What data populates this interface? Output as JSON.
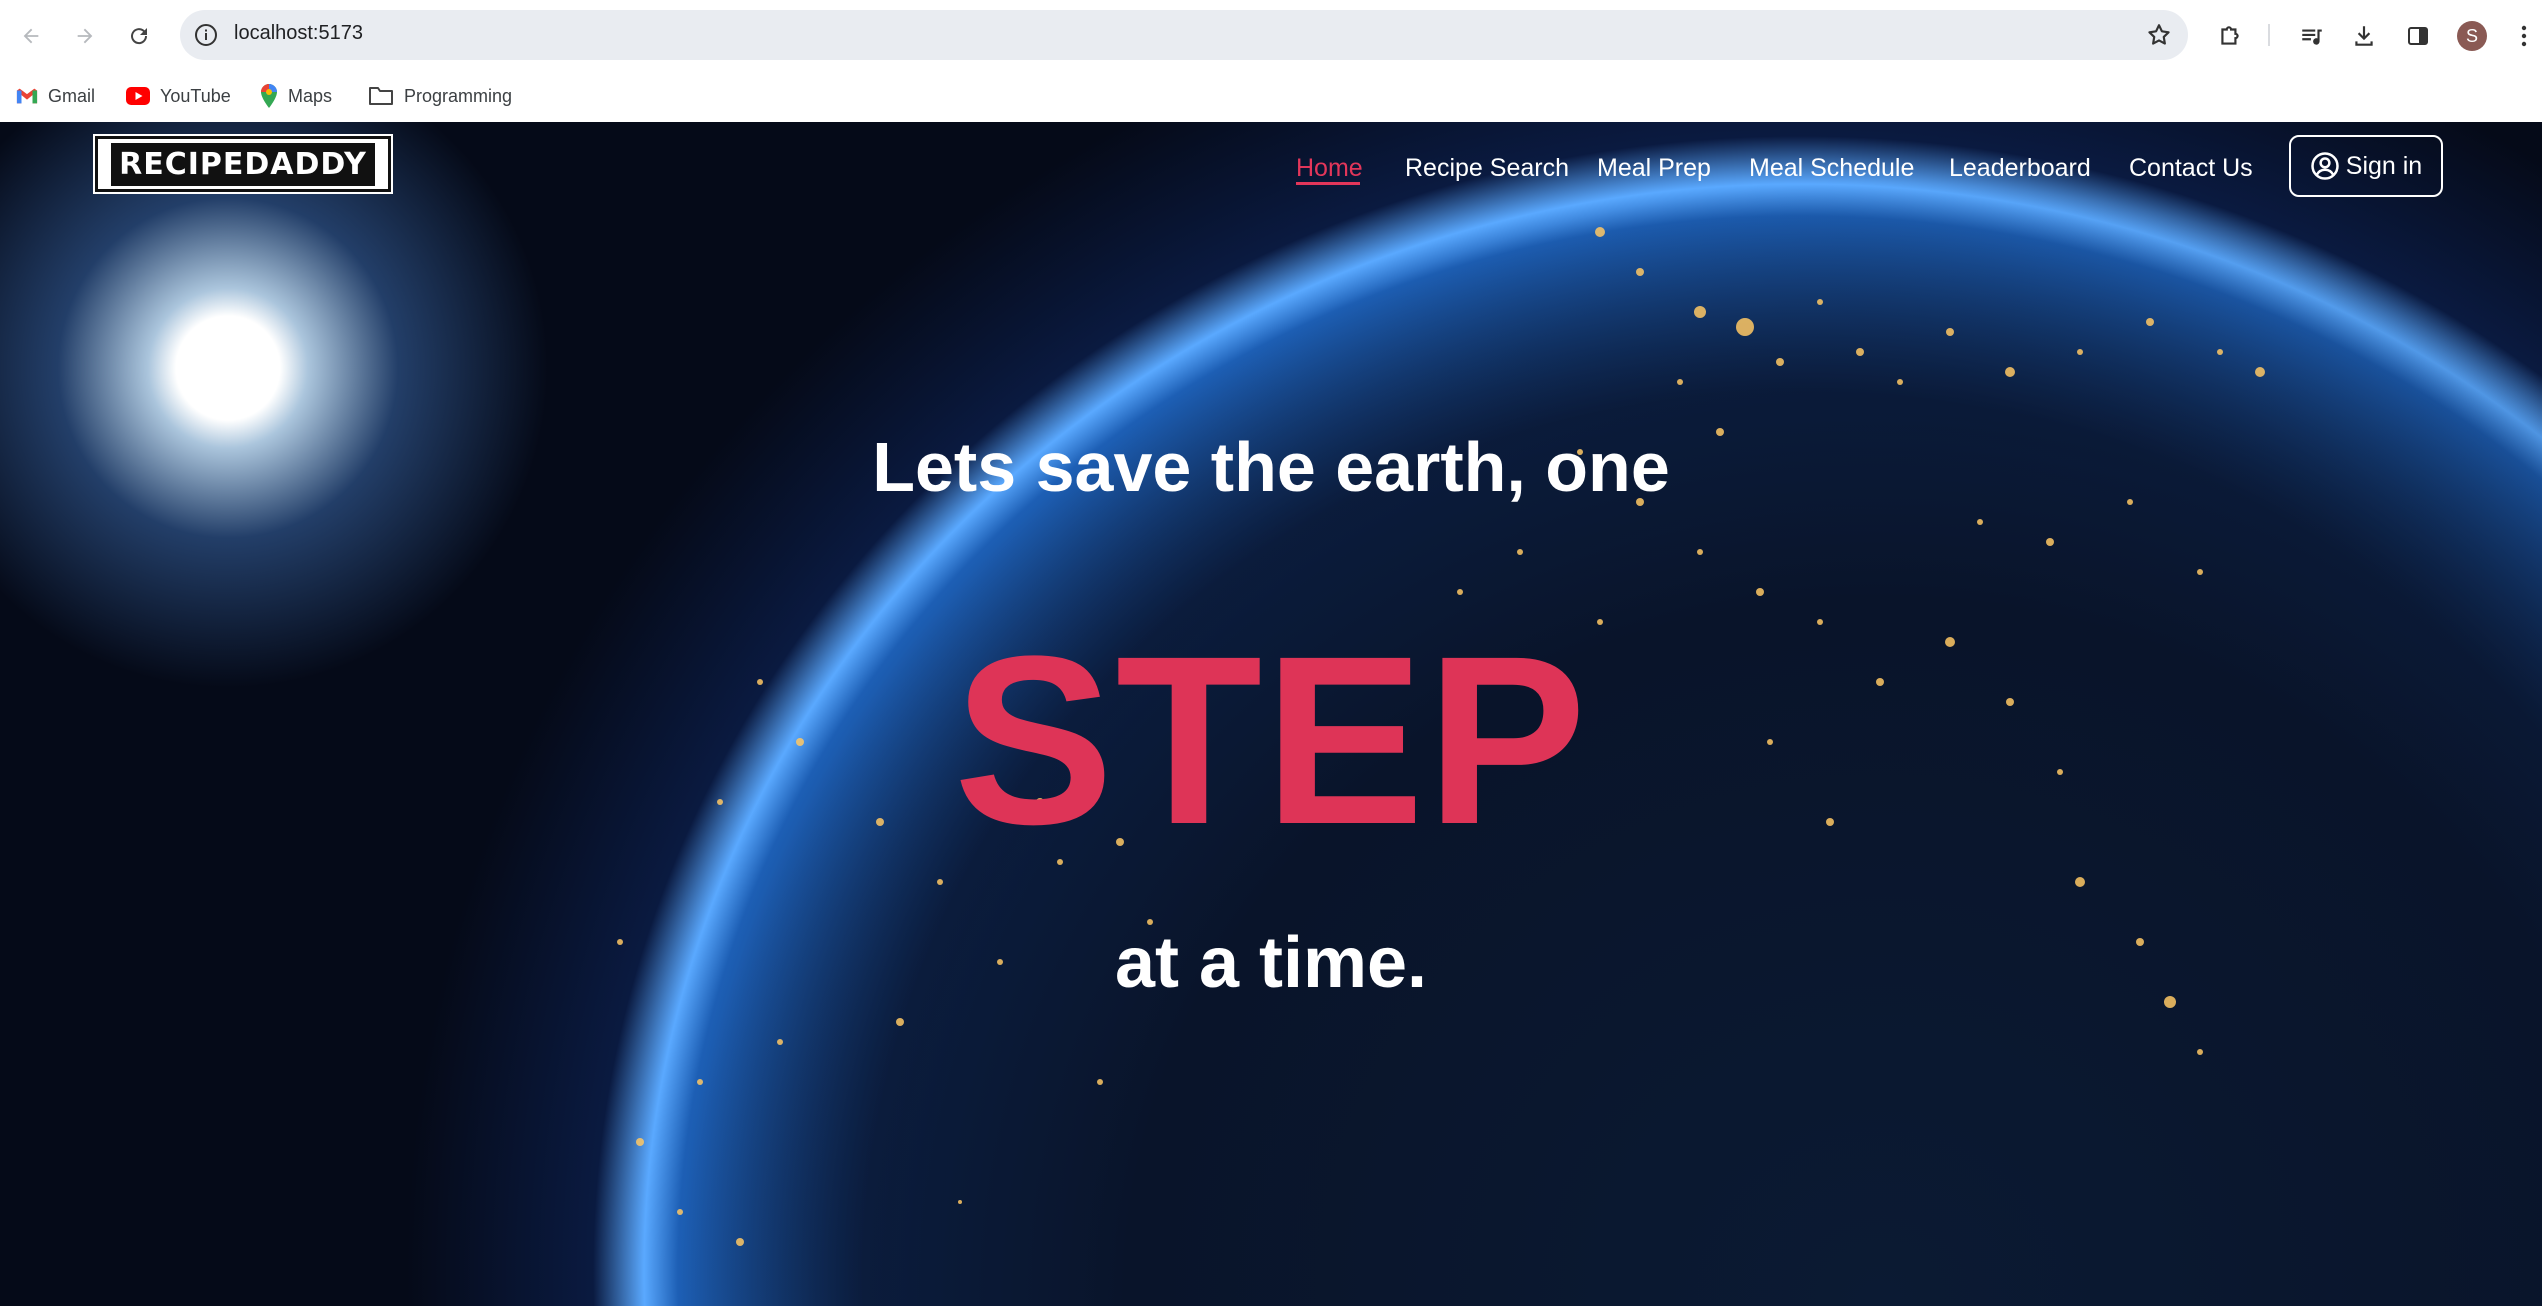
{
  "browser": {
    "url": "localhost:5173",
    "profile_initial": "S",
    "icons": {
      "back": "arrow-left-icon",
      "forward": "arrow-right-icon",
      "reload": "reload-icon",
      "site_info": "info-icon",
      "bookmark": "star-icon",
      "extensions": "puzzle-icon",
      "media": "media-queue-icon",
      "downloads": "download-icon",
      "side_panel": "side-panel-icon",
      "menu": "more-vert-icon"
    }
  },
  "bookmarks": [
    {
      "label": "Gmail",
      "icon": "gmail-icon"
    },
    {
      "label": "YouTube",
      "icon": "youtube-icon"
    },
    {
      "label": "Maps",
      "icon": "maps-pin-icon"
    },
    {
      "label": "Programming",
      "icon": "folder-icon"
    }
  ],
  "site": {
    "logo": "RECIPEDADDY",
    "nav": [
      "Home",
      "Recipe Search",
      "Meal Prep",
      "Meal Schedule",
      "Leaderboard",
      "Contact Us"
    ],
    "active_nav": "Home",
    "signin_label": "Sign in",
    "signin_icon": "user-circle-icon"
  },
  "hero": {
    "line1": "Lets save the earth, one",
    "highlight": "STEP",
    "line3": "at a time."
  },
  "colors": {
    "accent": "#e2365a",
    "step": "#de3457",
    "omnibox": "#e9ecf1"
  }
}
